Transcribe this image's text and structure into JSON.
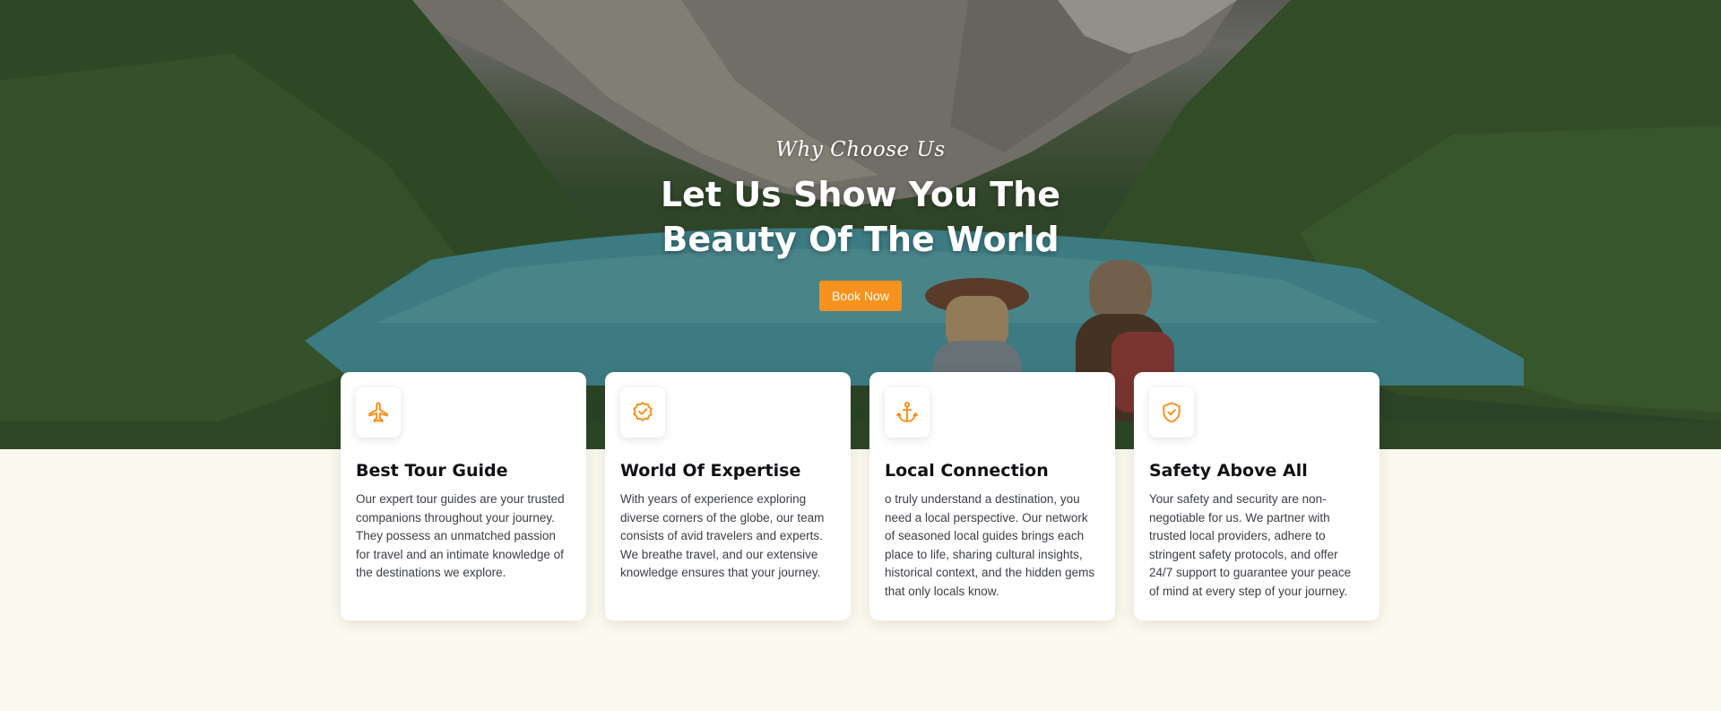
{
  "hero": {
    "eyebrow": "Why Choose Us",
    "title": "Let Us Show You The Beauty Of The World",
    "button_label": "Book Now"
  },
  "cards": [
    {
      "icon": "airplane-icon",
      "title": "Best Tour Guide",
      "text": "Our expert tour guides are your trusted companions throughout your journey. They possess an unmatched passion for travel and an intimate knowledge of the destinations we explore."
    },
    {
      "icon": "badge-check-icon",
      "title": "World Of Expertise",
      "text": "With years of experience exploring diverse corners of the globe, our team consists of avid travelers and experts. We breathe travel, and our extensive knowledge ensures that your journey."
    },
    {
      "icon": "anchor-icon",
      "title": "Local Connection",
      "text": "o truly understand a destination, you need a local perspective. Our network of seasoned local guides brings each place to life, sharing cultural insights, historical context, and the hidden gems that only locals know."
    },
    {
      "icon": "shield-check-icon",
      "title": "Safety Above All",
      "text": "Your safety and security are non-negotiable for us. We partner with trusted local providers, adhere to stringent safety protocols, and offer 24/7 support to guarantee your peace of mind at every step of your journey."
    }
  ],
  "colors": {
    "accent": "#f7921e",
    "page_background": "#fcf9ee",
    "card_background": "#ffffff",
    "heading_text": "#0f1114",
    "body_text": "#3c4046"
  }
}
